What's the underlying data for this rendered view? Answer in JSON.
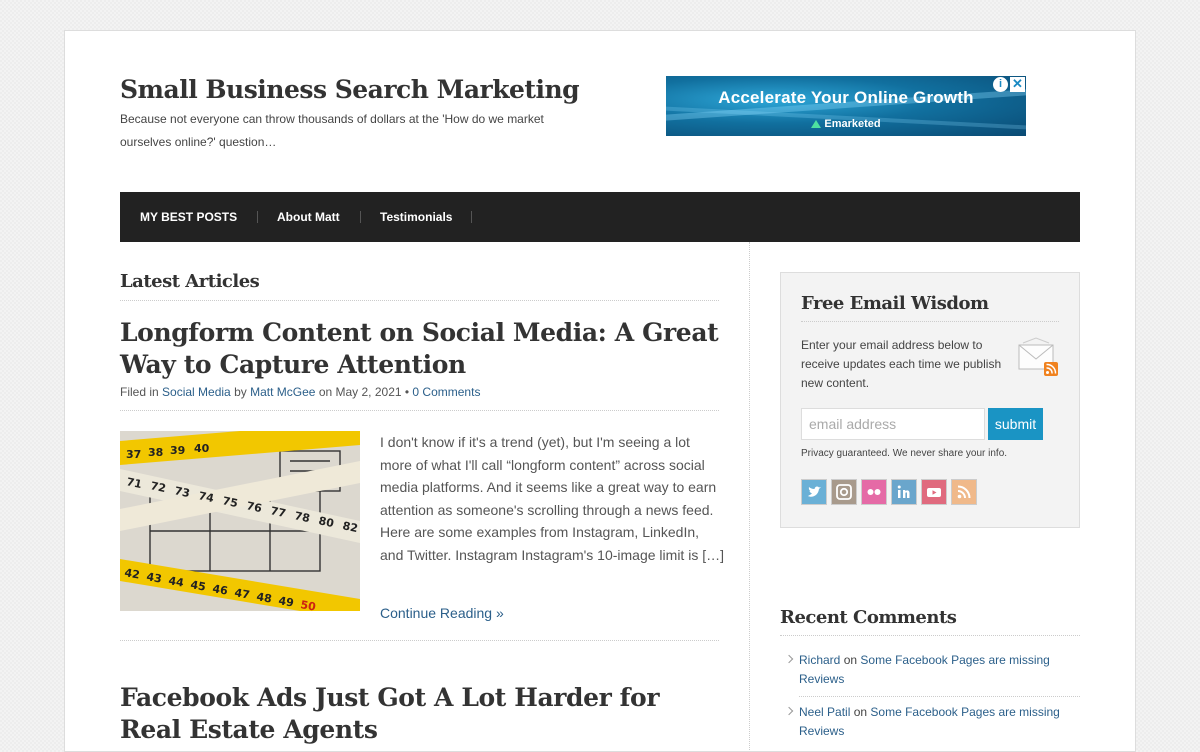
{
  "site": {
    "title": "Small Business Search Marketing",
    "description": "Because not everyone can throw thousands of dollars at the 'How do we market ourselves online?' question…"
  },
  "ad": {
    "headline": "Accelerate Your Online Growth",
    "brand": "Emarketed",
    "info_glyph": "i",
    "close_glyph": "✕"
  },
  "nav": {
    "items": [
      {
        "label": "MY BEST POSTS"
      },
      {
        "label": "About Matt"
      },
      {
        "label": "Testimonials"
      }
    ]
  },
  "main": {
    "section_heading": "Latest Articles",
    "posts": [
      {
        "title": "Longform Content on Social Media: A Great Way to Capture Attention",
        "meta_filed": "Filed in",
        "category": "Social Media",
        "meta_by": "by",
        "author": "Matt McGee",
        "meta_on": "on May 2, 2021 •",
        "comments": "0 Comments",
        "excerpt": "I don't know if it's a trend (yet), but I'm seeing a lot more of what I'll call “longform content” across social media platforms. And it seems like a great way to earn attention as someone's scrolling through a news feed. Here are some examples from Instagram, LinkedIn, and Twitter. Instagram Instagram's 10-image limit is […]",
        "continue_label": "Continue Reading »"
      },
      {
        "title": "Facebook Ads Just Got A Lot Harder for Real Estate Agents"
      }
    ]
  },
  "sidebar": {
    "email_widget": {
      "heading": "Free Email Wisdom",
      "text": "Enter your email address below to receive updates each time we publish new content.",
      "input_placeholder": "email address",
      "submit_label": "submit",
      "privacy": "Privacy guaranteed. We never share your info.",
      "social": [
        {
          "icon": "twitter-icon",
          "color": "#6ab0d6"
        },
        {
          "icon": "instagram-icon",
          "color": "#a89a8c"
        },
        {
          "icon": "flickr-icon",
          "color": "#e56aa6"
        },
        {
          "icon": "linkedin-icon",
          "color": "#6aa6cc"
        },
        {
          "icon": "youtube-icon",
          "color": "#e06a7e"
        },
        {
          "icon": "rss-icon",
          "color": "#f0b98a"
        }
      ]
    },
    "recent_comments": {
      "heading": "Recent Comments",
      "items": [
        {
          "author": "Richard",
          "on": "on",
          "post": "Some Facebook Pages are missing Reviews"
        },
        {
          "author": "Neel Patil",
          "on": "on",
          "post": "Some Facebook Pages are missing Reviews"
        }
      ]
    }
  }
}
